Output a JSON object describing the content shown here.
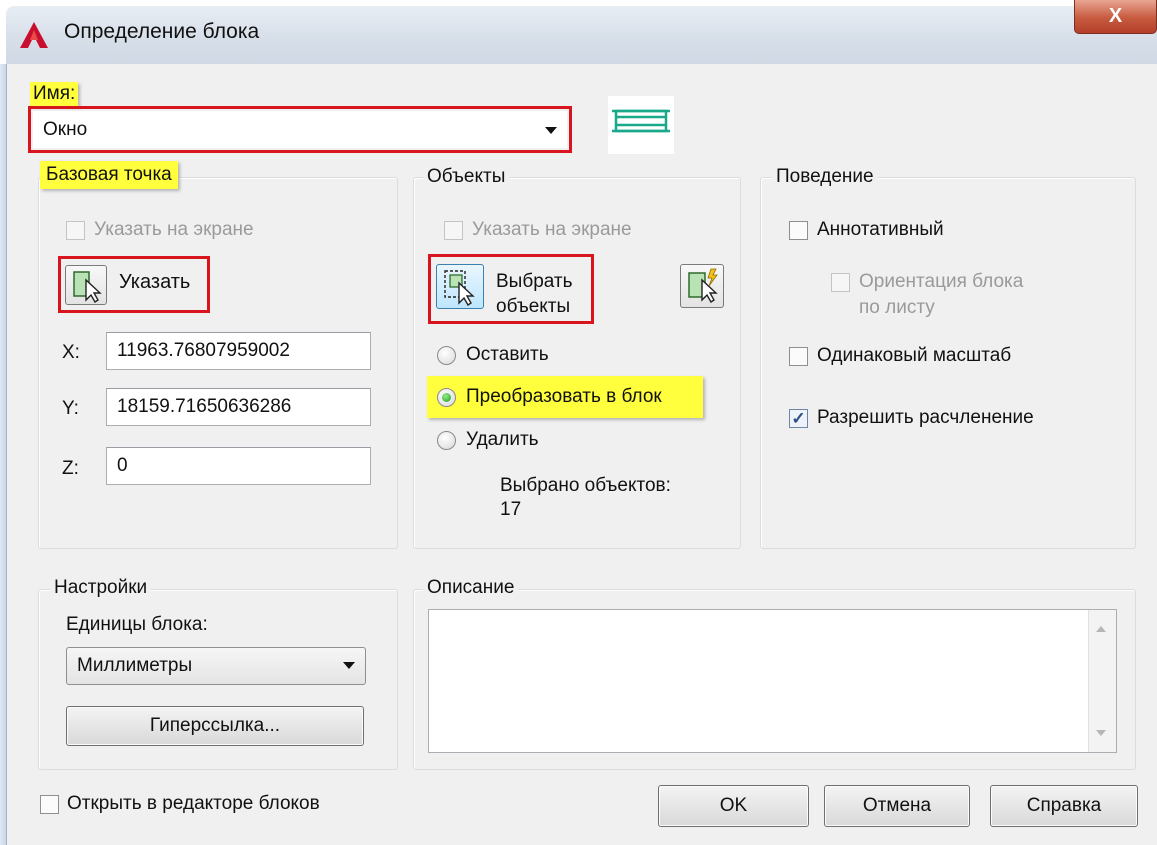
{
  "window": {
    "title": "Определение блока",
    "close_label": "X"
  },
  "name": {
    "label": "Имя:",
    "value": "Окно"
  },
  "base_point": {
    "title": "Базовая точка",
    "specify_on_screen": "Указать на экране",
    "pick_label": "Указать",
    "x_label": "X:",
    "y_label": "Y:",
    "z_label": "Z:",
    "x_value": "11963.76807959002",
    "y_value": "18159.71650636286",
    "z_value": "0"
  },
  "objects": {
    "title": "Объекты",
    "specify_on_screen": "Указать на экране",
    "select_label_line1": "Выбрать",
    "select_label_line2": "объекты",
    "retain": "Оставить",
    "convert": "Преобразовать в блок",
    "delete": "Удалить",
    "selected_caption": "Выбрано объектов:",
    "selected_count": "17",
    "mode_selected": "convert"
  },
  "behavior": {
    "title": "Поведение",
    "annotative": "Аннотативный",
    "orientation_line1": "Ориентация блока",
    "orientation_line2": "по листу",
    "uniform_scale": "Одинаковый масштаб",
    "allow_explode": "Разрешить расчленение",
    "annotative_checked": false,
    "uniform_scale_checked": false,
    "allow_explode_checked": true
  },
  "settings": {
    "title": "Настройки",
    "units_label": "Единицы блока:",
    "units_value": "Миллиметры",
    "hyperlink_label": "Гиперссылка..."
  },
  "description": {
    "title": "Описание",
    "text": ""
  },
  "footer": {
    "open_in_editor": "Открыть в редакторе блоков",
    "ok": "OK",
    "cancel": "Отмена",
    "help": "Справка"
  },
  "colors": {
    "highlight": "#ffff3d",
    "outline_red": "#d8141f",
    "preview_green": "#1aa88a",
    "app_red": "#c8102e"
  },
  "icons": [
    "autocad-logo-icon",
    "block-preview-icon",
    "pick-point-icon",
    "select-objects-icon",
    "quick-select-icon",
    "chevron-down-icon",
    "scroll-up-icon",
    "scroll-down-icon"
  ]
}
